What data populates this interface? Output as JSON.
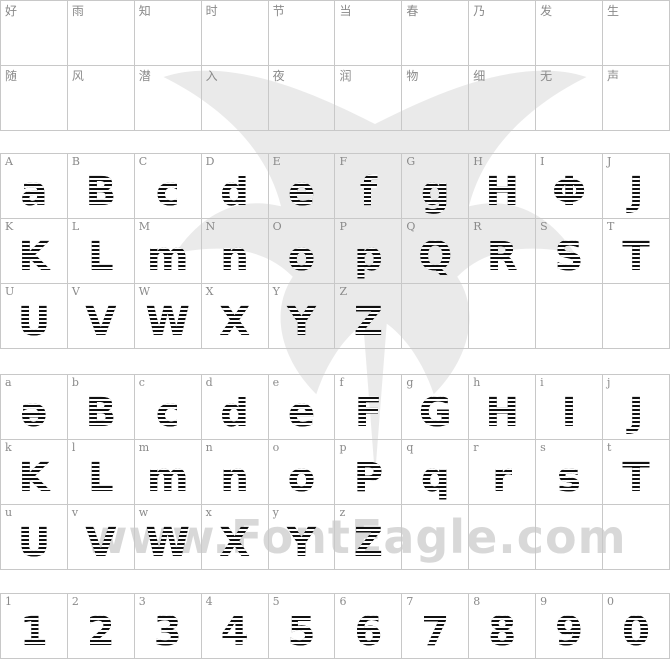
{
  "cjk_rows": [
    [
      "好",
      "雨",
      "知",
      "时",
      "节",
      "当",
      "春",
      "乃",
      "发",
      "生"
    ],
    [
      "随",
      "风",
      "潜",
      "入",
      "夜",
      "润",
      "物",
      "细",
      "无",
      "声"
    ]
  ],
  "upper_rows": [
    [
      {
        "label": "A",
        "glyph": "a"
      },
      {
        "label": "B",
        "glyph": "B"
      },
      {
        "label": "C",
        "glyph": "c"
      },
      {
        "label": "D",
        "glyph": "d"
      },
      {
        "label": "E",
        "glyph": "e"
      },
      {
        "label": "F",
        "glyph": "f"
      },
      {
        "label": "G",
        "glyph": "g"
      },
      {
        "label": "H",
        "glyph": "H"
      },
      {
        "label": "I",
        "glyph": "Φ"
      },
      {
        "label": "J",
        "glyph": "J"
      }
    ],
    [
      {
        "label": "K",
        "glyph": "K"
      },
      {
        "label": "L",
        "glyph": "L"
      },
      {
        "label": "M",
        "glyph": "m"
      },
      {
        "label": "N",
        "glyph": "n"
      },
      {
        "label": "O",
        "glyph": "o"
      },
      {
        "label": "P",
        "glyph": "p"
      },
      {
        "label": "Q",
        "glyph": "Q"
      },
      {
        "label": "R",
        "glyph": "R"
      },
      {
        "label": "S",
        "glyph": "S"
      },
      {
        "label": "T",
        "glyph": "T"
      }
    ],
    [
      {
        "label": "U",
        "glyph": "U"
      },
      {
        "label": "V",
        "glyph": "V"
      },
      {
        "label": "W",
        "glyph": "W"
      },
      {
        "label": "X",
        "glyph": "X"
      },
      {
        "label": "Y",
        "glyph": "Y"
      },
      {
        "label": "Z",
        "glyph": "Z"
      },
      {
        "label": "",
        "glyph": ""
      },
      {
        "label": "",
        "glyph": ""
      },
      {
        "label": "",
        "glyph": ""
      },
      {
        "label": "",
        "glyph": ""
      }
    ]
  ],
  "lower_rows": [
    [
      {
        "label": "a",
        "glyph": "ə"
      },
      {
        "label": "b",
        "glyph": "B"
      },
      {
        "label": "c",
        "glyph": "c"
      },
      {
        "label": "d",
        "glyph": "d"
      },
      {
        "label": "e",
        "glyph": "e"
      },
      {
        "label": "f",
        "glyph": "F"
      },
      {
        "label": "g",
        "glyph": "G"
      },
      {
        "label": "h",
        "glyph": "H"
      },
      {
        "label": "i",
        "glyph": "I"
      },
      {
        "label": "j",
        "glyph": "J"
      }
    ],
    [
      {
        "label": "k",
        "glyph": "K"
      },
      {
        "label": "l",
        "glyph": "L"
      },
      {
        "label": "m",
        "glyph": "m"
      },
      {
        "label": "n",
        "glyph": "n"
      },
      {
        "label": "o",
        "glyph": "o"
      },
      {
        "label": "p",
        "glyph": "P"
      },
      {
        "label": "q",
        "glyph": "q"
      },
      {
        "label": "r",
        "glyph": "r"
      },
      {
        "label": "s",
        "glyph": "s"
      },
      {
        "label": "t",
        "glyph": "T"
      }
    ],
    [
      {
        "label": "u",
        "glyph": "U"
      },
      {
        "label": "v",
        "glyph": "V"
      },
      {
        "label": "w",
        "glyph": "W"
      },
      {
        "label": "x",
        "glyph": "X"
      },
      {
        "label": "y",
        "glyph": "Y"
      },
      {
        "label": "z",
        "glyph": "Z"
      },
      {
        "label": "",
        "glyph": ""
      },
      {
        "label": "",
        "glyph": ""
      },
      {
        "label": "",
        "glyph": ""
      },
      {
        "label": "",
        "glyph": ""
      }
    ]
  ],
  "digit_row": [
    {
      "label": "1",
      "glyph": "1"
    },
    {
      "label": "2",
      "glyph": "2"
    },
    {
      "label": "3",
      "glyph": "3"
    },
    {
      "label": "4",
      "glyph": "4"
    },
    {
      "label": "5",
      "glyph": "5"
    },
    {
      "label": "6",
      "glyph": "6"
    },
    {
      "label": "7",
      "glyph": "7"
    },
    {
      "label": "8",
      "glyph": "8"
    },
    {
      "label": "9",
      "glyph": "9"
    },
    {
      "label": "0",
      "glyph": "0"
    }
  ],
  "watermark": {
    "text": "www.FontEagle.com",
    "icon": "eagle-icon"
  }
}
